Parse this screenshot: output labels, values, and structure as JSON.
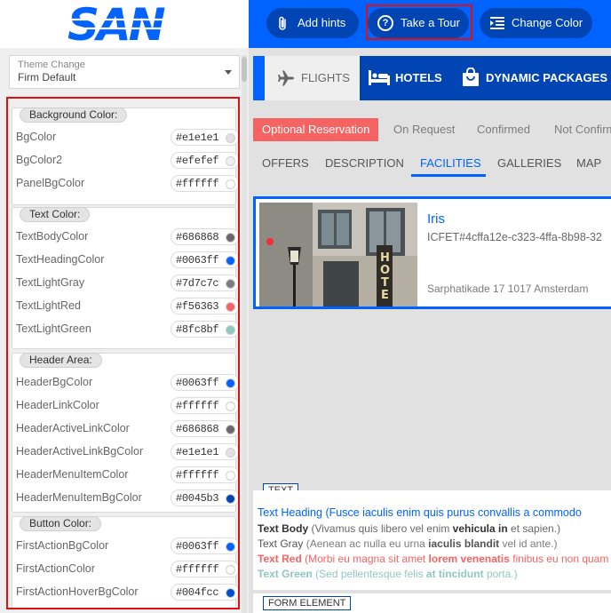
{
  "header": {
    "logo_text": "SAN",
    "buttons": {
      "add_hints": "Add hints",
      "take_tour": "Take a Tour",
      "change_color": "Change Color"
    }
  },
  "theme": {
    "label": "Theme Change",
    "value": "Firm Default"
  },
  "groups": {
    "background": {
      "title": "Background Color:",
      "rows": [
        {
          "name": "BgColor",
          "value": "#e1e1e1",
          "color": "#e1e1e1"
        },
        {
          "name": "BgColor2",
          "value": "#efefef",
          "color": "#efefef"
        },
        {
          "name": "PanelBgColor",
          "value": "#ffffff",
          "color": "#ffffff"
        }
      ]
    },
    "text": {
      "title": "Text Color:",
      "rows": [
        {
          "name": "TextBodyColor",
          "value": "#686868",
          "color": "#686868"
        },
        {
          "name": "TextHeadingColor",
          "value": "#0063ff",
          "color": "#0063ff"
        },
        {
          "name": "TextLightGray",
          "value": "#7d7c7c",
          "color": "#7d7c7c"
        },
        {
          "name": "TextLightRed",
          "value": "#f56363",
          "color": "#f56363"
        },
        {
          "name": "TextLightGreen",
          "value": "#8fc8bf",
          "color": "#8fc8bf"
        }
      ]
    },
    "header_area": {
      "title": "Header Area:",
      "rows": [
        {
          "name": "HeaderBgColor",
          "value": "#0063ff",
          "color": "#0063ff"
        },
        {
          "name": "HeaderLinkColor",
          "value": "#ffffff",
          "color": "#ffffff"
        },
        {
          "name": "HeaderActiveLinkColor",
          "value": "#686868",
          "color": "#686868"
        },
        {
          "name": "HeaderActiveLinkBgColor",
          "value": "#e1e1e1",
          "color": "#e1e1e1"
        },
        {
          "name": "HeaderMenuItemColor",
          "value": "#ffffff",
          "color": "#ffffff"
        },
        {
          "name": "HeaderMenuItemBgColor",
          "value": "#0045b3",
          "color": "#0045b3"
        }
      ]
    },
    "button": {
      "title": "Button Color:",
      "rows": [
        {
          "name": "FirstActionBgColor",
          "value": "#0063ff",
          "color": "#0063ff"
        },
        {
          "name": "FirstActionColor",
          "value": "#ffffff",
          "color": "#ffffff"
        },
        {
          "name": "FirstActionHoverBgColor",
          "value": "#004fcc",
          "color": "#004fcc"
        }
      ]
    }
  },
  "nav": {
    "flights": "FLIGHTS",
    "hotels": "HOTELS",
    "dynamic_packages": "DYNAMIC PACKAGES"
  },
  "status_tabs": [
    "Optional Reservation",
    "On Request",
    "Confirmed",
    "Not Confirmed"
  ],
  "content_tabs": [
    "OFFERS",
    "DESCRIPTION",
    "FACILITIES",
    "GALLERIES",
    "MAP"
  ],
  "hotel": {
    "name": "Iris",
    "code": "ICFET#4cffa12e-c323-4ffa-8b98-32",
    "address": "Sarphatikade 17 1017 Amsterdam"
  },
  "preview": {
    "text_label": "TEXT",
    "heading_label": "Text Heading",
    "heading_text": "(Fusce iaculis enim quis purus convallis a commodo",
    "body_label": "Text Body",
    "body_text_1": "(Vivamus quis libero vel enim",
    "body_bold": "vehicula in",
    "body_text_2": "et sapien.)",
    "gray_label": "Text Gray",
    "gray_text_1": "(Aenean ac nulla eu urna",
    "gray_bold": "iaculis blandit",
    "gray_text_2": "vel id ante.)",
    "red_label": "Text Red",
    "red_text_1": "(Morbi eu magna sit amet",
    "red_bold": "lorem venenatis",
    "red_text_2": "finibus eu non quam",
    "green_label": "Text Green",
    "green_text_1": "(Sed pellentesque felis",
    "green_bold": "at tincidunt",
    "green_text_2": "porta.)",
    "form_label": "FORM ELEMENT"
  }
}
